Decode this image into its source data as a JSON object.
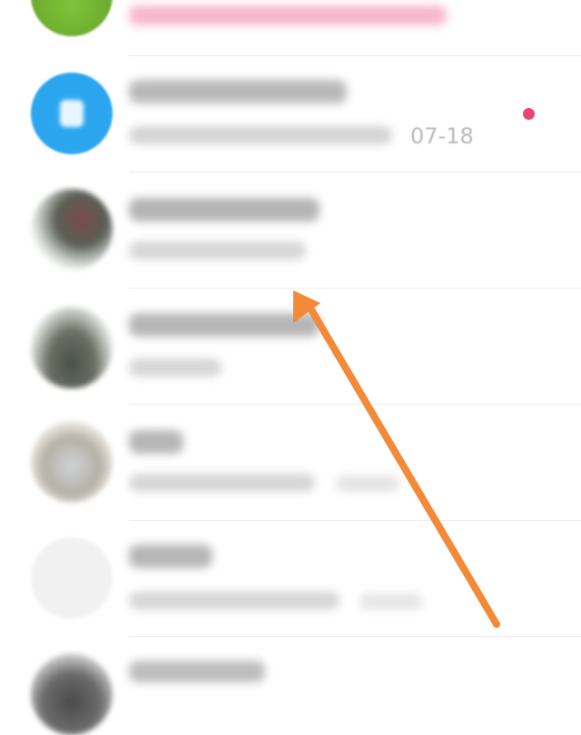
{
  "conversations": [
    {
      "avatar_icon": "green-circle-avatar",
      "preview_color": "#f07ea0"
    },
    {
      "avatar_icon": "blue-app-icon",
      "time": "07-18",
      "unread": true
    },
    {
      "avatar_icon": "photo-avatar"
    },
    {
      "avatar_icon": "photo-avatar"
    },
    {
      "avatar_icon": "photo-avatar"
    },
    {
      "avatar_icon": "placeholder-avatar"
    },
    {
      "avatar_icon": "photo-avatar"
    }
  ],
  "annotation": {
    "type": "arrow",
    "color": "#f28a3a"
  },
  "colors": {
    "unread_dot": "#ee4470",
    "app_blue": "#2ba6ee"
  }
}
